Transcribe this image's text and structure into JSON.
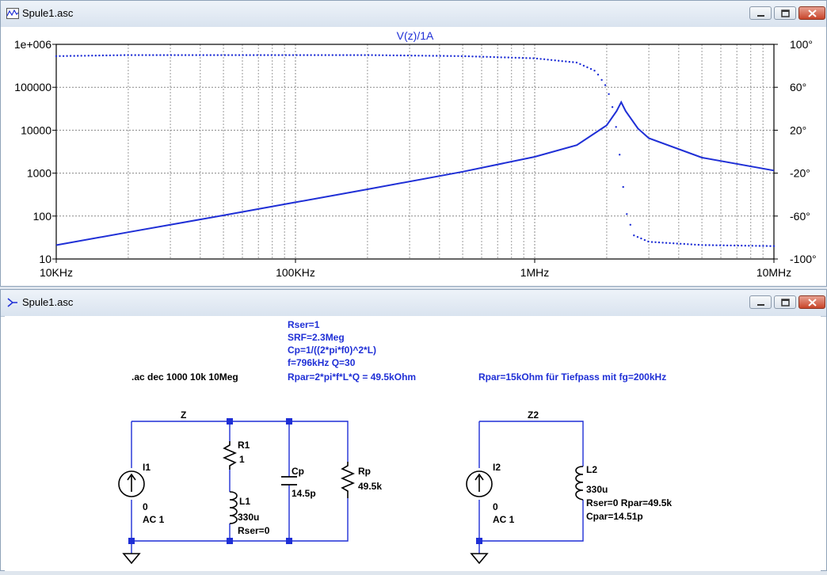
{
  "plot_window": {
    "title": "Spule1.asc",
    "icon": "waveform-viewer-icon"
  },
  "schematic_window": {
    "title": "Spule1.asc",
    "icon": "schematic-editor-icon"
  },
  "chart_data": {
    "type": "line",
    "title": "V(z)/1A",
    "x_scale": "log",
    "xlim": [
      10000,
      10000000
    ],
    "x_ticks": [
      "10KHz",
      "100KHz",
      "1MHz",
      "10MHz"
    ],
    "y_left_scale": "log",
    "ylim_left": [
      10,
      1000000
    ],
    "y_left_ticks": [
      "1e+006",
      "100000",
      "10000",
      "1000",
      "100",
      "10"
    ],
    "ylim_right": [
      -100,
      100
    ],
    "y_right_ticks": [
      "100°",
      "60°",
      "20°",
      "-20°",
      "-60°",
      "-100°"
    ],
    "grid": true,
    "series": [
      {
        "style": "solid",
        "axis": "left",
        "x": [
          10000,
          20000,
          50000,
          100000,
          200000,
          500000,
          1000000,
          1500000,
          2000000,
          2200000,
          2300000,
          2400000,
          2700000,
          3000000,
          5000000,
          10000000
        ],
        "y": [
          21,
          42,
          104,
          209,
          420,
          1080,
          2400,
          4500,
          13000,
          28000,
          45000,
          28000,
          11000,
          6500,
          2300,
          1150
        ]
      },
      {
        "style": "dotted",
        "axis": "right",
        "x": [
          10000,
          20000,
          50000,
          100000,
          200000,
          500000,
          1000000,
          1500000,
          1800000,
          2000000,
          2100000,
          2200000,
          2300000,
          2400000,
          2600000,
          3000000,
          5000000,
          10000000
        ],
        "y": [
          89,
          90,
          90,
          90,
          90,
          89,
          87,
          83,
          75,
          60,
          45,
          20,
          -15,
          -55,
          -78,
          -84,
          -87,
          -88
        ]
      }
    ]
  },
  "schematic": {
    "directive_ac": ".ac dec 1000 10k 10Meg",
    "notes": [
      "Rser=1",
      "SRF=2.3Meg",
      "Cp=1/((2*pi*f0)^2*L)",
      "f=796kHz Q=30",
      "Rpar=2*pi*f*L*Q = 49.5kOhm"
    ],
    "note2": "Rpar=15kOhm für Tiefpass mit fg=200kHz",
    "left": {
      "net": "Z",
      "source": {
        "name": "I1",
        "value": "0",
        "ac": "AC 1"
      },
      "r1": {
        "name": "R1",
        "value": "1"
      },
      "l1": {
        "name": "L1",
        "value": "330u",
        "extra": "Rser=0"
      },
      "cp": {
        "name": "Cp",
        "value": "14.5p"
      },
      "rp": {
        "name": "Rp",
        "value": "49.5k"
      }
    },
    "right": {
      "net": "Z2",
      "source": {
        "name": "I2",
        "value": "0",
        "ac": "AC 1"
      },
      "l2": {
        "name": "L2",
        "value": "330u",
        "extra1": "Rser=0 Rpar=49.5k",
        "extra2": "Cpar=14.51p"
      }
    }
  }
}
